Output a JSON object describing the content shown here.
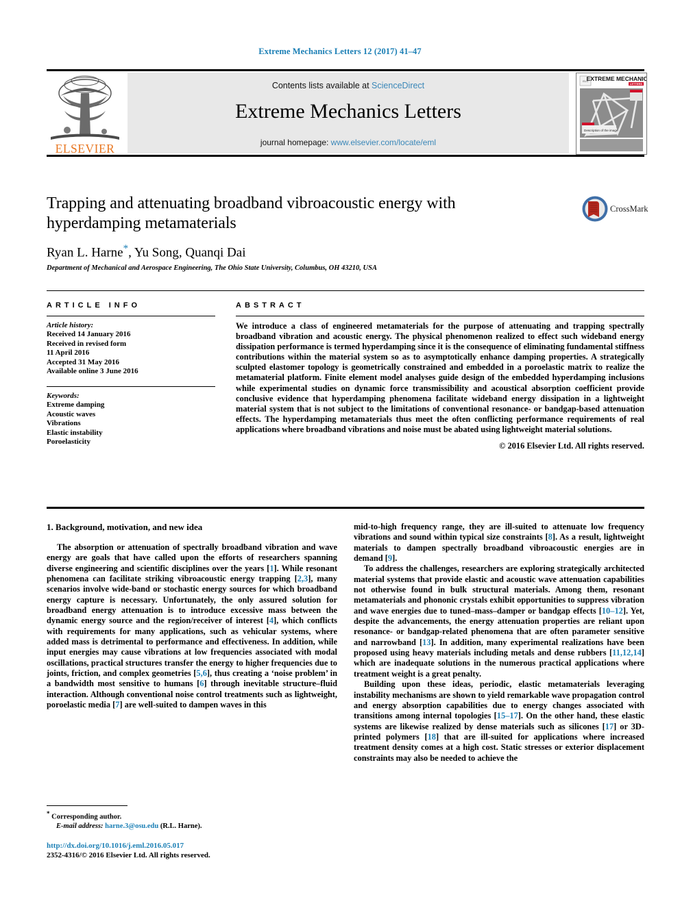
{
  "running_head": "Extreme Mechanics Letters 12 (2017) 41–47",
  "masthead": {
    "contents_prefix": "Contents lists available at ",
    "sciencedirect": "ScienceDirect",
    "journal_title": "Extreme Mechanics Letters",
    "homepage_prefix": "journal homepage: ",
    "homepage_url": "www.elsevier.com/locate/eml",
    "publisher_wordmark": "ELSEVIER",
    "cover_title_line1": "EXTREME MECHANICS",
    "cover_title_line2": "LETTERS",
    "cover_caption": "Description of the image",
    "link_color": "#3a87b8",
    "band_color": "#e8e8e8",
    "elsevier_orange": "#e87722"
  },
  "article": {
    "title": "Trapping and attenuating broadband vibroacoustic energy with hyperdamping metamaterials",
    "authors_pre": "Ryan L. Harne",
    "authors_post": ", Yu Song, Quanqi Dai",
    "corresponding_marker": "*",
    "affiliation": "Department of Mechanical and Aerospace Engineering, The Ohio State University, Columbus, OH 43210, USA",
    "crossmark_label": "CrossMark"
  },
  "info": {
    "heading": "ARTICLE INFO",
    "history_label": "Article history:",
    "history": [
      "Received 14 January 2016",
      "Received in revised form",
      "11 April 2016",
      "Accepted 31 May 2016",
      "Available online 3 June 2016"
    ],
    "keywords_label": "Keywords:",
    "keywords": [
      "Extreme damping",
      "Acoustic waves",
      "Vibrations",
      "Elastic instability",
      "Poroelasticity"
    ]
  },
  "abstract": {
    "heading": "ABSTRACT",
    "text": "We introduce a class of engineered metamaterials for the purpose of attenuating and trapping spectrally broadband vibration and acoustic energy. The physical phenomenon realized to effect such wideband energy dissipation performance is termed hyperdamping since it is the consequence of eliminating fundamental stiffness contributions within the material system so as to asymptotically enhance damping properties. A strategically sculpted elastomer topology is geometrically constrained and embedded in a poroelastic matrix to realize the metamaterial platform. Finite element model analyses guide design of the embedded hyperdamping inclusions while experimental studies on dynamic force transmissibility and acoustical absorption coefficient provide conclusive evidence that hyperdamping phenomena facilitate wideband energy dissipation in a lightweight material system that is not subject to the limitations of conventional resonance- or bandgap-based attenuation effects. The hyperdamping metamaterials thus meet the often conflicting performance requirements of real applications where broadband vibrations and noise must be abated using lightweight material solutions.",
    "copyright": "© 2016 Elsevier Ltd. All rights reserved."
  },
  "body": {
    "section_heading": "1. Background, motivation, and new idea",
    "left_paragraph_1": {
      "s1": "The absorption or attenuation of spectrally broadband vibration and wave energy are goals that have called upon the efforts of researchers spanning diverse engineering and scientific disciplines over the years [",
      "c1": "1",
      "s2": "]. While resonant phenomena can facilitate striking vibroacoustic energy trapping [",
      "c2": "2,3",
      "s3": "], many scenarios involve wide-band or stochastic energy sources for which broadband energy capture is necessary. Unfortunately, the only assured solution for broadband energy attenuation is to introduce excessive mass between the dynamic energy source and the region/receiver of interest [",
      "c3": "4",
      "s4": "], which conflicts with requirements for many applications, such as vehicular systems, where added mass is detrimental to performance and effectiveness. In addition, while input energies may cause vibrations at low frequencies associated with modal oscillations, practical structures transfer the energy to higher frequencies due to joints, friction, and complex geometries [",
      "c4": "5,6",
      "s5": "], thus creating a ‘noise problem’ in a bandwidth most sensitive to humans [",
      "c5": "6",
      "s6": "] through inevitable structure–fluid interaction. Although conventional noise control treatments such as lightweight, poroelastic media [",
      "c6": "7",
      "s7": "] are well-suited to dampen waves in this"
    },
    "right_paragraph_1": {
      "s1": "mid-to-high frequency range, they are ill-suited to attenuate low frequency vibrations and sound within typical size constraints [",
      "c1": "8",
      "s2": "]. As a result, lightweight materials to dampen spectrally broadband vibroacoustic energies are in demand [",
      "c2": "9",
      "s3": "]."
    },
    "right_paragraph_2": {
      "s1": "To address the challenges, researchers are exploring strategically architected material systems that provide elastic and acoustic wave attenuation capabilities not otherwise found in bulk structural materials. Among them, resonant metamaterials and phononic crystals exhibit opportunities to suppress vibration and wave energies due to tuned–mass–damper or bandgap effects [",
      "c1": "10–12",
      "s2": "]. Yet, despite the advancements, the energy attenuation properties are reliant upon resonance- or bandgap-related phenomena that are often parameter sensitive and narrowband [",
      "c2": "13",
      "s3": "]. In addition, many experimental realizations have been proposed using heavy materials including metals and dense rubbers [",
      "c3": "11,12,14",
      "s4": "] which are inadequate solutions in the numerous practical applications where treatment weight is a great penalty."
    },
    "right_paragraph_3": {
      "s1": "Building upon these ideas, periodic, elastic metamaterials leveraging instability mechanisms are shown to yield remarkable wave propagation control and energy absorption capabilities due to energy changes associated with transitions among internal topologies [",
      "c1": "15–17",
      "s2": "]. On the other hand, these elastic systems are likewise realized by dense materials such as silicones [",
      "c2": "17",
      "s3": "] or 3D-printed polymers [",
      "c3": "18",
      "s4": "] that are ill-suited for applications where increased treatment density comes at a high cost. Static stresses or exterior displacement constraints may also be needed to achieve the"
    }
  },
  "footer": {
    "corresponding": "Corresponding author.",
    "email_label": "E-mail address: ",
    "email": "harne.3@osu.edu",
    "email_suffix": " (R.L. Harne).",
    "doi": "http://dx.doi.org/10.1016/j.eml.2016.05.017",
    "issn_line": "2352-4316/© 2016 Elsevier Ltd. All rights reserved.",
    "cite_color": "#1b7fb5"
  }
}
